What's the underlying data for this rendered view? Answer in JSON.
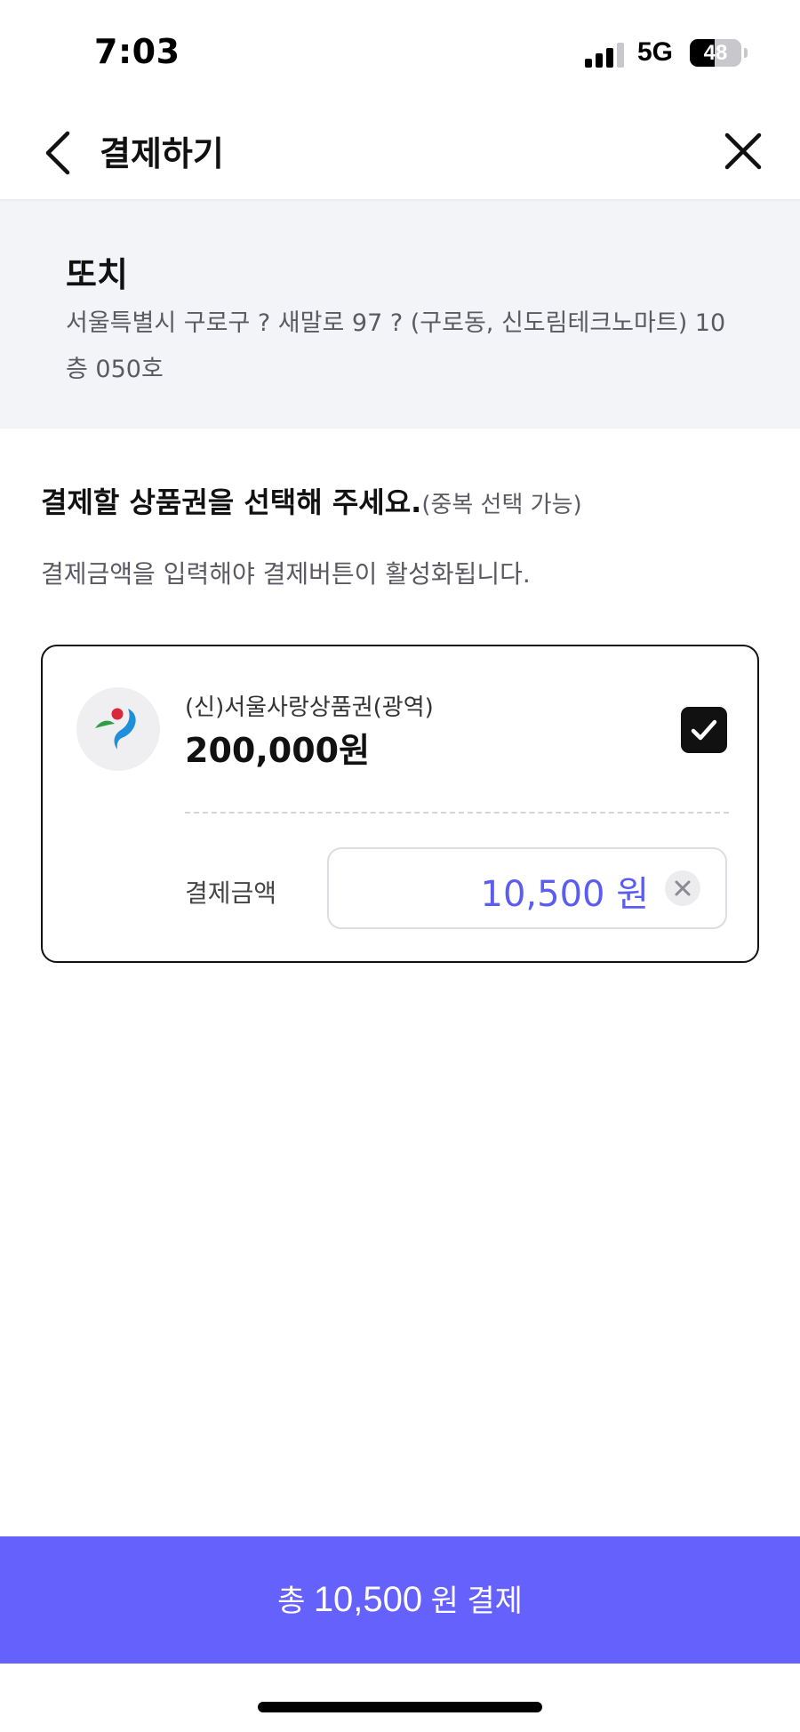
{
  "status_bar": {
    "time": "7:03",
    "network": "5G",
    "battery_level": "48",
    "battery_fraction": 0.48
  },
  "header": {
    "title": "결제하기",
    "back_icon": "chevron-left-icon",
    "close_icon": "close-icon"
  },
  "store": {
    "name": "또치",
    "address": "서울특별시 구로구 ? 새말로 97 ? (구로동, 신도림테크노마트) 10층 050호"
  },
  "instructions": {
    "title": "결제할 상품권을 선택해 주세요.",
    "subtitle": "(중복 선택 가능)",
    "description": "결제금액을 입력해야 결제버튼이 활성화됩니다."
  },
  "voucher": {
    "name": "(신)서울사랑상품권(광역)",
    "balance": "200,000원",
    "checked": true,
    "amount_label": "결제금액",
    "amount_value": "10,500",
    "amount_unit": "원",
    "clear_icon": "clear-icon"
  },
  "pay_button": {
    "prefix": "총",
    "amount": "10,500",
    "suffix": "원 결제"
  },
  "colors": {
    "accent": "#6461fc",
    "amount_text": "#5b5cf0",
    "store_bg": "#f3f4f8",
    "card_border": "#111111"
  }
}
